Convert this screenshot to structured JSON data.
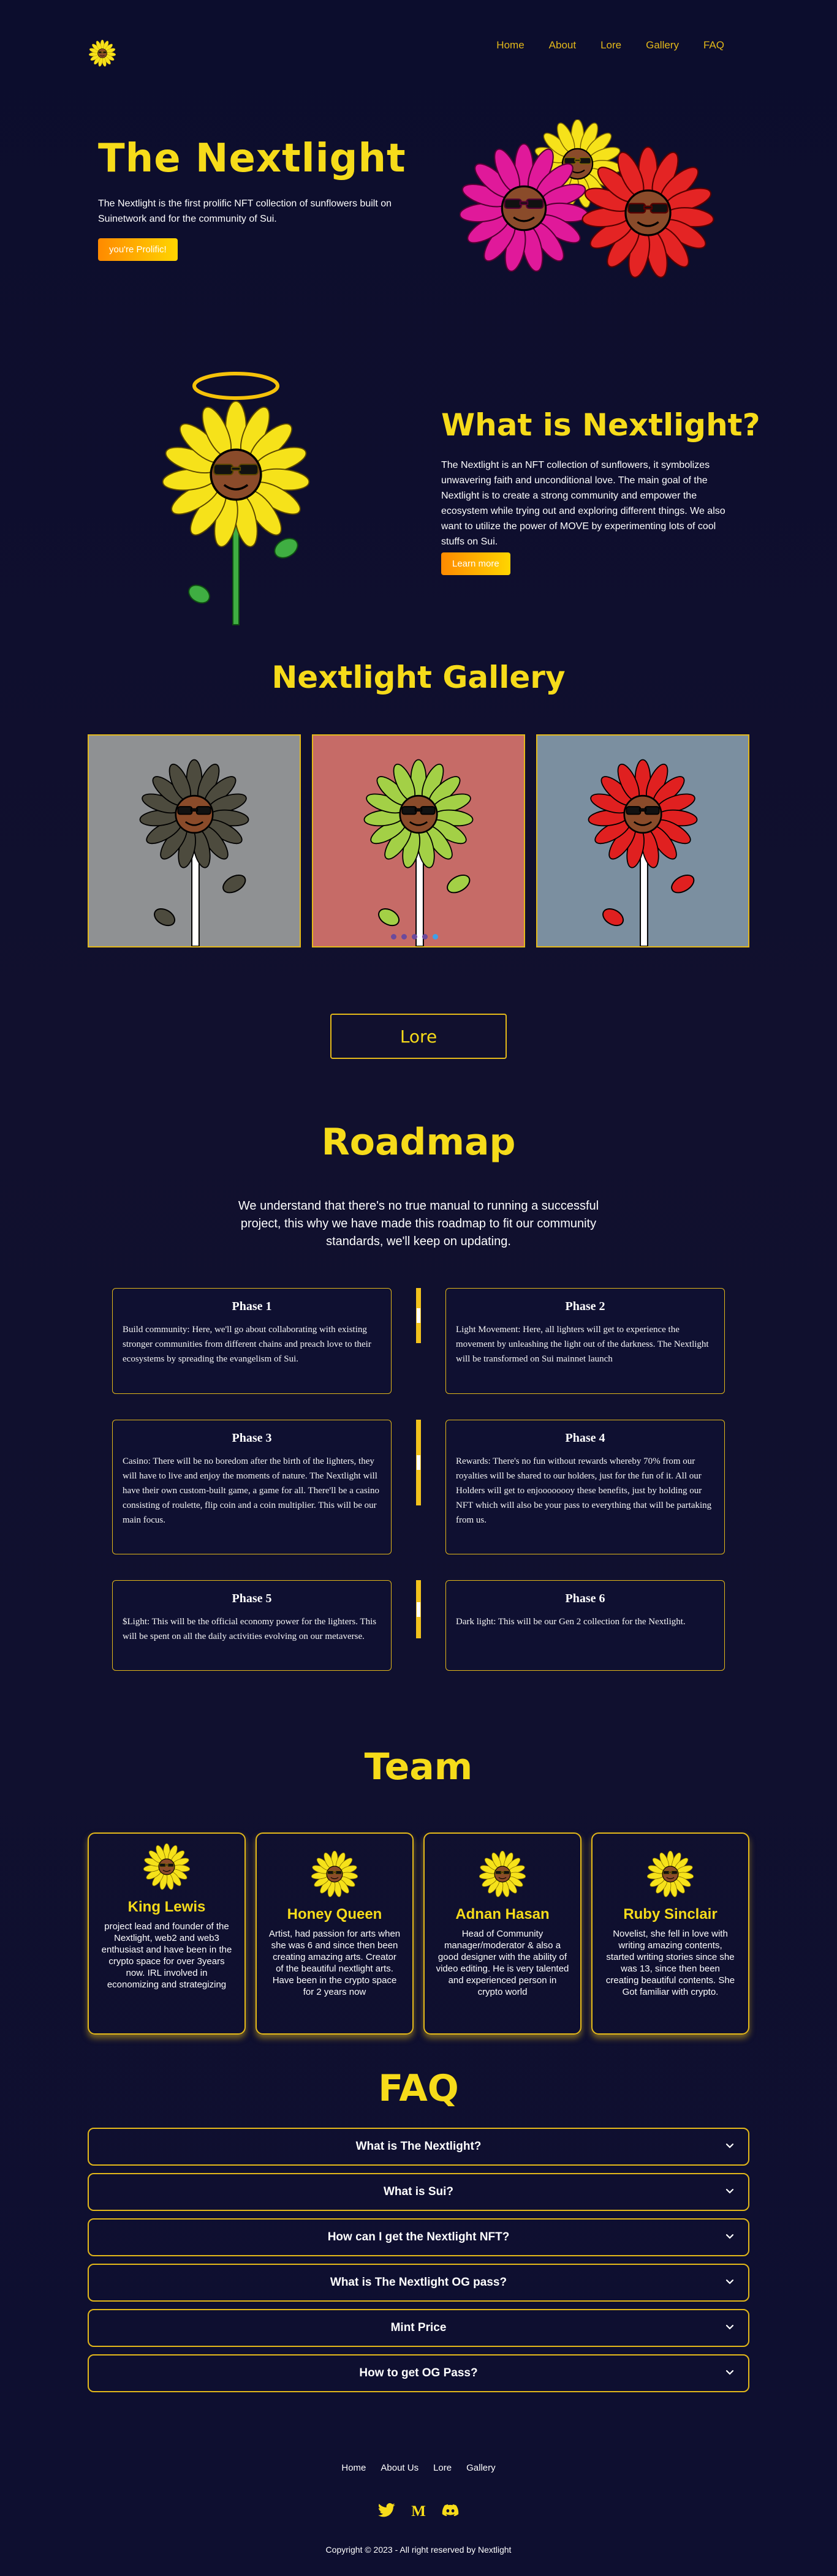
{
  "nav": {
    "logo_icon": "sunflower-logo-icon",
    "links": [
      "Home",
      "About",
      "Lore",
      "Gallery",
      "FAQ"
    ]
  },
  "hero": {
    "title": "The Nextlight",
    "description": "The Nextlight is the first prolific NFT collection of sunflowers built on Suinetwork and for the community of Sui.",
    "button": "you're Prolific!"
  },
  "about": {
    "title": "What is Nextlight?",
    "description": "The Nextlight is an NFT collection of sunflowers, it symbolizes unwavering faith and unconditional love. The main goal of the Nextlight is to create a strong community and empower the ecosystem while trying out and exploring different things. We also want to utilize the power of MOVE by experimenting lots of cool stuffs on Sui.",
    "button": "Learn more"
  },
  "gallery": {
    "title": "Nextlight Gallery",
    "card_colors": [
      "#8f9193",
      "#c66b67",
      "#7b8fa0"
    ],
    "petal_colors": [
      "#4d4b3e",
      "#a3d046",
      "#e02020"
    ]
  },
  "lore": {
    "button": "Lore"
  },
  "roadmap": {
    "title": "Roadmap",
    "description": "We understand that there's no true manual to running a successful project, this why we have made this roadmap to fit our community standards, we'll keep on updating.",
    "phases": [
      {
        "title": "Phase 1",
        "text": "Build community: Here, we'll go about collaborating with existing stronger communities from different chains and preach love to their ecosystems by spreading the evangelism of Sui."
      },
      {
        "title": "Phase 2",
        "text": "Light Movement: Here, all lighters will get to experience the movement by unleashing the light out of the darkness. The Nextlight will be transformed on Sui mainnet launch"
      },
      {
        "title": "Phase 3",
        "text": "Casino: There will be no boredom after the birth of the lighters, they will have to live and enjoy the moments of nature. The Nextlight will have their own custom-built game, a game for all. There'll be a casino consisting of roulette, flip coin and a coin multiplier. This will be our main focus."
      },
      {
        "title": "Phase 4",
        "text": "Rewards: There's no fun without rewards whereby 70% from our royalties will be shared to our holders, just for the fun of it. All our Holders will get to enjoooooooy these benefits, just by holding our NFT which will also be your pass to everything that will be partaking from us."
      },
      {
        "title": "Phase 5",
        "text": "$Light: This will be the official economy power for the lighters. This will be spent on all the daily activities evolving on our metaverse."
      },
      {
        "title": "Phase 6",
        "text": "Dark light: This will be our Gen 2 collection for the Nextlight."
      }
    ]
  },
  "team": {
    "title": "Team",
    "members": [
      {
        "name": "King Lewis",
        "bio": "project lead and founder of the Nextlight, web2 and web3 enthusiast and have been in the crypto space for over 3years now. IRL involved in economizing and strategizing"
      },
      {
        "name": "Honey Queen",
        "bio": "Artist, had passion for arts when she was 6 and since then been creating amazing arts. Creator of the beautiful nextlight arts. Have been in the crypto space for 2 years now"
      },
      {
        "name": "Adnan Hasan",
        "bio": "Head of Community manager/moderator & also a good designer with the ability of video editing. He is very talented and experienced person in crypto world"
      },
      {
        "name": "Ruby Sinclair",
        "bio": "Novelist, she fell in love with writing amazing contents, started writing stories since she was 13, since then been creating beautiful contents. She Got familiar with crypto."
      }
    ]
  },
  "faq": {
    "title": "FAQ",
    "questions": [
      "What is The Nextlight?",
      "What is Sui?",
      "How can I get the Nextlight NFT?",
      "What is The Nextlight OG pass?",
      "Mint Price",
      "How to get OG Pass?"
    ]
  },
  "footer": {
    "links": [
      "Home",
      "About Us",
      "Lore",
      "Gallery"
    ],
    "socials": [
      "twitter-icon",
      "medium-icon",
      "discord-icon"
    ],
    "copyright": "Copyright © 2023 - All right reserved by Nextlight"
  },
  "colors": {
    "accent": "#f6db1a",
    "border": "#e3b81a",
    "background": "#0c0d2d",
    "button_gradient_start": "#ff8a00",
    "button_gradient_end": "#ffd500"
  }
}
